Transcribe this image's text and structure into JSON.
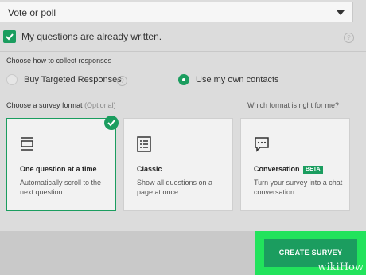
{
  "survey_type": {
    "selected": "Vote or poll"
  },
  "written": {
    "label": "My questions are already written.",
    "checked": true
  },
  "collect": {
    "title": "Choose how to collect responses",
    "options": [
      {
        "label": "Buy Targeted Responses",
        "selected": false
      },
      {
        "label": "Use my own contacts",
        "selected": true
      }
    ]
  },
  "format": {
    "title": "Choose a survey format",
    "optional": "(Optional)",
    "help_link": "Which format is right for me?",
    "cards": [
      {
        "title": "One question at a time",
        "desc": "Automatically scroll to the next question",
        "icon": "single-question-icon",
        "selected": true
      },
      {
        "title": "Classic",
        "desc": "Show all questions on a page at once",
        "icon": "list-icon",
        "selected": false
      },
      {
        "title": "Conversation",
        "badge": "BETA",
        "desc": "Turn your survey into a chat conversation",
        "icon": "chat-icon",
        "selected": false
      }
    ]
  },
  "actions": {
    "create": "CREATE SURVEY"
  },
  "watermark": "wikiHow",
  "colors": {
    "accent": "#1b9d5f",
    "highlight": "#22e35c",
    "background": "#dcdcdc"
  }
}
